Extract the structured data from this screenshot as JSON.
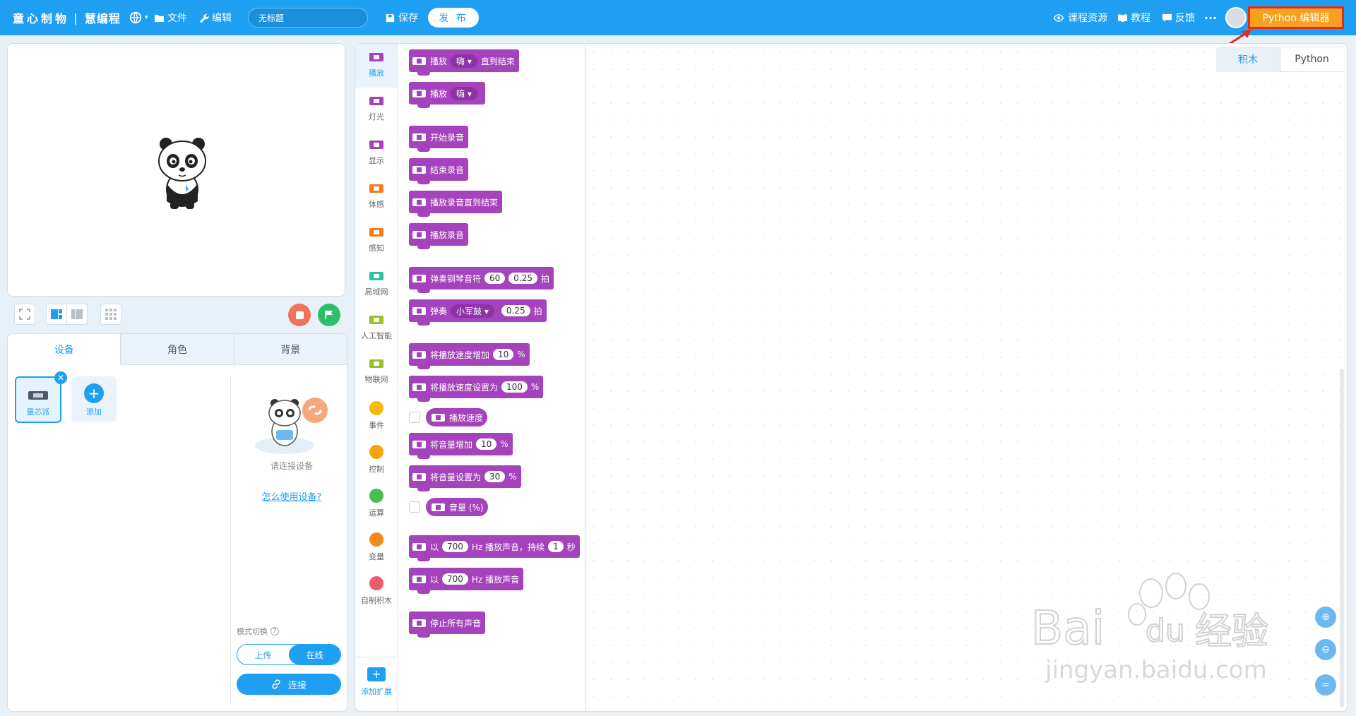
{
  "topbar": {
    "brand": "童心制物",
    "product": "慧编程",
    "file_label": "文件",
    "edit_label": "编辑",
    "project_title": "无标题",
    "save_label": "保存",
    "publish_label": "发 布",
    "course_label": "课程资源",
    "tutorial_label": "教程",
    "feedback_label": "反馈",
    "more_label": "···",
    "python_editor_label": "Python 编辑器"
  },
  "device_panel": {
    "tabs": [
      "设备",
      "角色",
      "背景"
    ],
    "active_tab": "设备",
    "device_name": "童芯派",
    "add_label": "添加",
    "connect_hint": "请连接设备",
    "howto_link": "怎么使用设备?",
    "mode_label": "模式切换",
    "mode_upload": "上传",
    "mode_online": "在线",
    "connect_label": "连接"
  },
  "categories": [
    {
      "label": "播放",
      "color": "#a443bb",
      "shape": "device"
    },
    {
      "label": "灯光",
      "color": "#a443bb",
      "shape": "device"
    },
    {
      "label": "显示",
      "color": "#a443bb",
      "shape": "device"
    },
    {
      "label": "体感",
      "color": "#f07d1e",
      "shape": "device"
    },
    {
      "label": "感知",
      "color": "#f07d1e",
      "shape": "device"
    },
    {
      "label": "局域网",
      "color": "#2cc3a0",
      "shape": "device"
    },
    {
      "label": "人工智能",
      "color": "#9bbf2a",
      "shape": "device"
    },
    {
      "label": "物联网",
      "color": "#9bbf2a",
      "shape": "device"
    },
    {
      "label": "事件",
      "color": "#f8b80d",
      "shape": "dot"
    },
    {
      "label": "控制",
      "color": "#f8a30d",
      "shape": "dot"
    },
    {
      "label": "运算",
      "color": "#4cbd54",
      "shape": "dot"
    },
    {
      "label": "变量",
      "color": "#f38a1f",
      "shape": "dot"
    },
    {
      "label": "自制积木",
      "color": "#f05a6e",
      "shape": "dot"
    }
  ],
  "add_extension_label": "添加扩展",
  "blocks": {
    "b1": {
      "t1": "播放",
      "dd": "嗨",
      "t2": "直到结束"
    },
    "b2": {
      "t1": "播放",
      "dd": "嗨"
    },
    "b3": "开始录音",
    "b4": "结束录音",
    "b5": "播放录音直到结束",
    "b6": "播放录音",
    "b7": {
      "t1": "弹奏钢琴音符",
      "v1": "60",
      "v2": "0.25",
      "t2": "拍"
    },
    "b8": {
      "t1": "弹奏",
      "dd": "小军鼓",
      "v1": "0.25",
      "t2": "拍"
    },
    "b9": {
      "t1": "将播放速度增加",
      "v1": "10",
      "t2": "%"
    },
    "b10": {
      "t1": "将播放速度设置为",
      "v1": "100",
      "t2": "%"
    },
    "b11": "播放速度",
    "b12": {
      "t1": "将音量增加",
      "v1": "10",
      "t2": "%"
    },
    "b13": {
      "t1": "将音量设置为",
      "v1": "30",
      "t2": "%"
    },
    "b14": "音量 (%)",
    "b15": {
      "t1": "以",
      "v1": "700",
      "t2": "Hz 播放声音，持续",
      "v2": "1",
      "t3": "秒"
    },
    "b16": {
      "t1": "以",
      "v1": "700",
      "t2": "Hz 播放声音"
    },
    "b17": "停止所有声音"
  },
  "workspace": {
    "tab_blocks": "积木",
    "tab_python": "Python"
  },
  "watermark": {
    "text": "Bai du 经验",
    "url": "jingyan.baidu.com"
  }
}
